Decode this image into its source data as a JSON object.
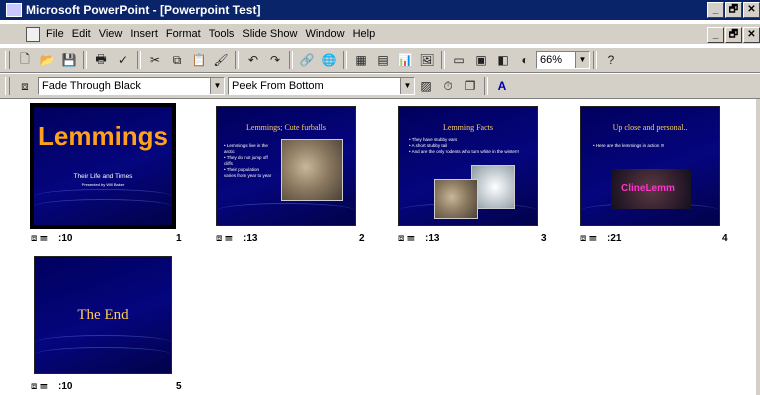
{
  "window": {
    "title": "Microsoft PowerPoint - [Powerpoint Test]",
    "controls": [
      "_",
      "🗗",
      "✕"
    ]
  },
  "menu": [
    "File",
    "Edit",
    "View",
    "Insert",
    "Format",
    "Tools",
    "Slide Show",
    "Window",
    "Help"
  ],
  "standard_toolbar": {
    "zoom": "66%"
  },
  "sorter_toolbar": {
    "transition_effect": "Fade Through Black",
    "text_preset": "Peek From Bottom"
  },
  "slides": [
    {
      "number": "1",
      "timing": ":10",
      "title": "Lemmings",
      "subtitle": "Their Life and Times",
      "byline": "Presented by Will Baker",
      "selected": true
    },
    {
      "number": "2",
      "timing": ":13",
      "title": "Lemmings; Cute furballs",
      "bullets": [
        "Lemmings live in the arctic",
        "They do not jump off cliffs",
        "Their population varies from year to year"
      ]
    },
    {
      "number": "3",
      "timing": ":13",
      "title": "Lemming Facts",
      "bullets": [
        "They have stubby ears",
        "A short stubby tail",
        "And are the only rodents who turn white in the winter!!"
      ]
    },
    {
      "number": "4",
      "timing": ":21",
      "title": "Up close and personal..",
      "bullets": [
        "Here are the lemmings in action !!!"
      ],
      "video_label": "ClineLemm"
    },
    {
      "number": "5",
      "timing": ":10",
      "title": "The End"
    }
  ]
}
